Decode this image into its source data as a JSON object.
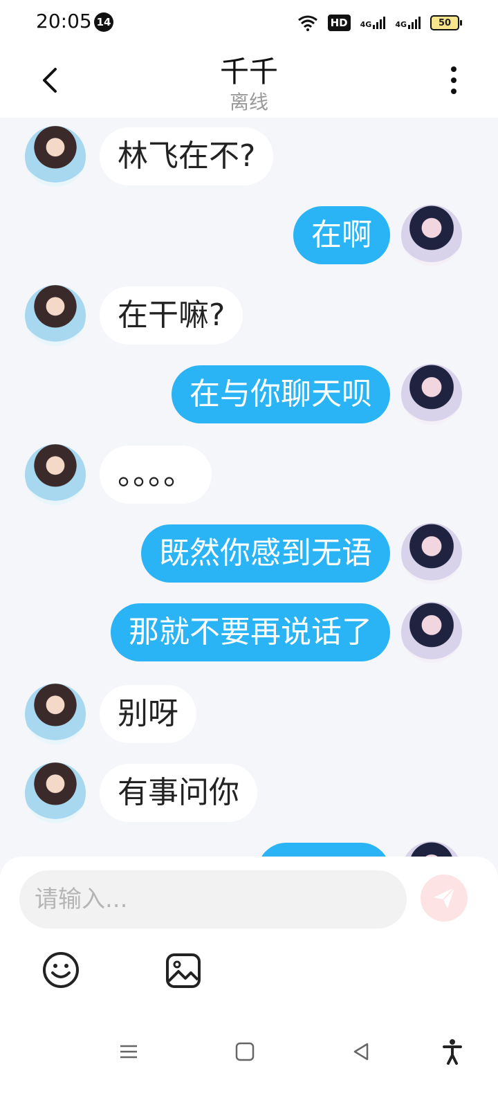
{
  "status_bar": {
    "time": "20:05",
    "notification_count": "14",
    "hd_label": "HD",
    "network1": "4G",
    "network2": "4G",
    "battery": "50"
  },
  "header": {
    "title": "千千",
    "subtitle": "离线"
  },
  "messages": [
    {
      "side": "left",
      "text": "林飞在不?"
    },
    {
      "side": "right",
      "text": "在啊"
    },
    {
      "side": "left",
      "text": "在干嘛?"
    },
    {
      "side": "right",
      "text": "在与你聊天呗"
    },
    {
      "side": "left",
      "text": "。。。。"
    },
    {
      "side": "right",
      "text": "既然你感到无语"
    },
    {
      "side": "right",
      "text": "那就不要再说话了"
    },
    {
      "side": "left",
      "text": "别呀"
    },
    {
      "side": "left",
      "text": "有事问你"
    },
    {
      "side": "right",
      "text": ""
    }
  ],
  "composer": {
    "placeholder": "请输入..."
  },
  "icons": {
    "back": "back-arrow-icon",
    "more": "more-vertical-icon",
    "send": "send-icon",
    "emoji": "emoji-icon",
    "image": "image-icon",
    "nav_menu": "menu-icon",
    "nav_home": "home-icon",
    "nav_back": "back-triangle-icon",
    "accessibility": "accessibility-icon"
  },
  "colors": {
    "accent": "#2ab4f5",
    "background": "#f4f6f9",
    "send_button": "#fde3e3"
  }
}
